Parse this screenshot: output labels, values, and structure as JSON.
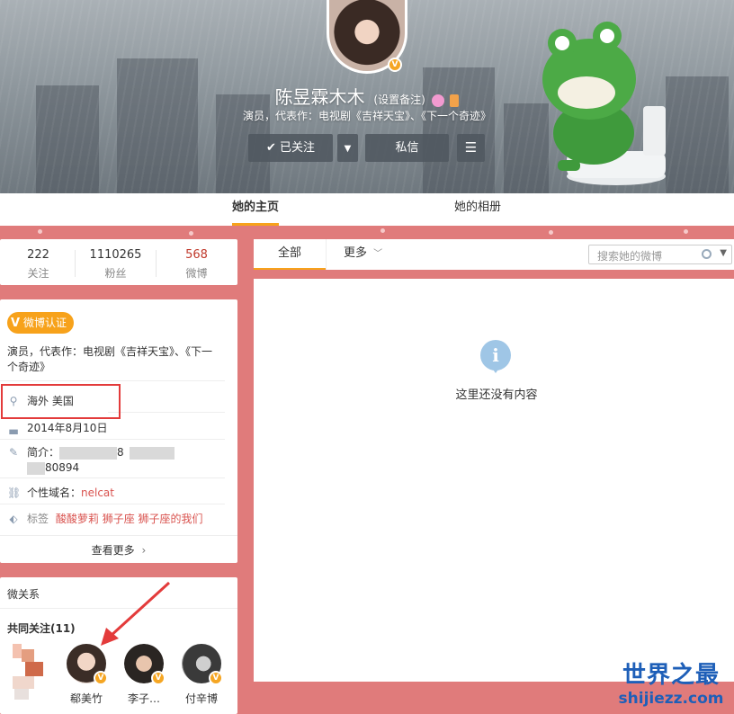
{
  "profile": {
    "name": "陈昱霖木木",
    "remark": "(设置备注)",
    "description": "演员，代表作：电视剧《吉祥天宝》、《下一个奇迹》",
    "follow_button": "已关注",
    "message_button": "私信"
  },
  "nav_tabs": [
    "她的主页",
    "她的相册"
  ],
  "stats": [
    {
      "value": "222",
      "label": "关注"
    },
    {
      "value": "1110265",
      "label": "粉丝"
    },
    {
      "value": "568",
      "label": "微博"
    }
  ],
  "info": {
    "verify_badge": "微博认证",
    "verify_text_line1": "演员，代表作：电视剧《吉祥天宝》、《下一",
    "verify_text_line2": "个奇迹》",
    "location": "海外 美国",
    "birthday": "2014年8月10日",
    "intro_label": "简介：",
    "intro_mid": "8",
    "intro_tail": "80894",
    "domain_label": "个性域名：",
    "domain_value": "nelcat",
    "tags_label": "标签",
    "tags": [
      "酸酸萝莉",
      "狮子座",
      "狮子座的我们"
    ],
    "see_more": "查看更多"
  },
  "relations": {
    "title": "微关系",
    "common_follow": "共同关注(11)",
    "users": [
      {
        "name": ""
      },
      {
        "name": "郗美竹"
      },
      {
        "name": "李子…"
      },
      {
        "name": "付辛博"
      }
    ]
  },
  "feed": {
    "tab_all": "全部",
    "tab_more": "更多",
    "search_placeholder": "搜索她的微博",
    "empty_icon": "i",
    "empty_text": "这里还没有内容"
  },
  "watermark": {
    "title": "世界之最",
    "domain": "shijiezz.com"
  },
  "colors": {
    "accent": "#f7a21b",
    "page_bg": "#e07b7b",
    "highlight_red": "#e33b3b"
  },
  "icons": [
    "location-icon",
    "birthday-icon",
    "intro-icon",
    "link-icon",
    "tag-icon",
    "search-icon",
    "verified-v-icon"
  ]
}
